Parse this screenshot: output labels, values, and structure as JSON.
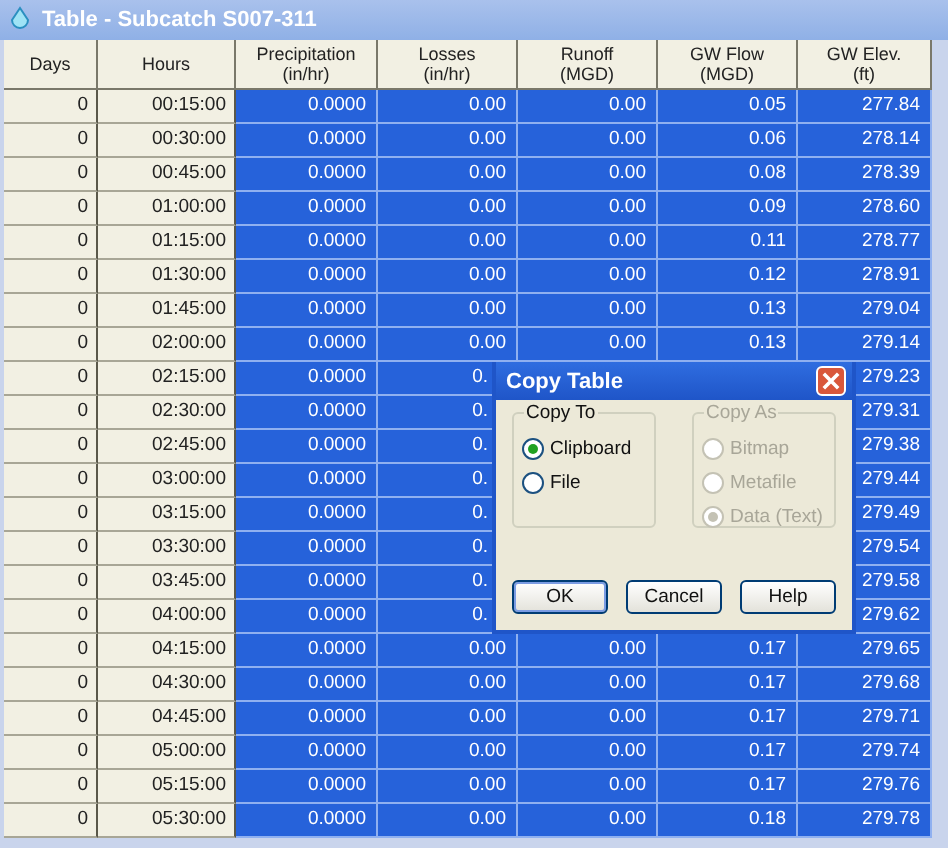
{
  "window": {
    "title": "Table - Subcatch S007-311"
  },
  "table": {
    "columns": [
      {
        "title": "Days"
      },
      {
        "title": "Hours"
      },
      {
        "title": "Precipitation",
        "unit": "(in/hr)"
      },
      {
        "title": "Losses",
        "unit": "(in/hr)"
      },
      {
        "title": "Runoff",
        "unit": "(MGD)"
      },
      {
        "title": "GW Flow",
        "unit": "(MGD)"
      },
      {
        "title": "GW Elev.",
        "unit": "(ft)"
      }
    ],
    "rows": [
      {
        "cells": [
          "0",
          "00:15:00",
          "0.0000",
          "0.00",
          "0.00",
          "0.05",
          "277.84"
        ]
      },
      {
        "cells": [
          "0",
          "00:30:00",
          "0.0000",
          "0.00",
          "0.00",
          "0.06",
          "278.14"
        ]
      },
      {
        "cells": [
          "0",
          "00:45:00",
          "0.0000",
          "0.00",
          "0.00",
          "0.08",
          "278.39"
        ]
      },
      {
        "cells": [
          "0",
          "01:00:00",
          "0.0000",
          "0.00",
          "0.00",
          "0.09",
          "278.60"
        ]
      },
      {
        "cells": [
          "0",
          "01:15:00",
          "0.0000",
          "0.00",
          "0.00",
          "0.11",
          "278.77"
        ]
      },
      {
        "cells": [
          "0",
          "01:30:00",
          "0.0000",
          "0.00",
          "0.00",
          "0.12",
          "278.91"
        ]
      },
      {
        "cells": [
          "0",
          "01:45:00",
          "0.0000",
          "0.00",
          "0.00",
          "0.13",
          "279.04"
        ]
      },
      {
        "cells": [
          "0",
          "02:00:00",
          "0.0000",
          "0.00",
          "0.00",
          "0.13",
          "279.14"
        ]
      },
      {
        "cells": [
          "0",
          "02:15:00",
          "0.0000",
          "0.",
          null,
          null,
          "279.23"
        ]
      },
      {
        "cells": [
          "0",
          "02:30:00",
          "0.0000",
          "0.",
          null,
          null,
          "279.31"
        ]
      },
      {
        "cells": [
          "0",
          "02:45:00",
          "0.0000",
          "0.",
          null,
          null,
          "279.38"
        ]
      },
      {
        "cells": [
          "0",
          "03:00:00",
          "0.0000",
          "0.",
          null,
          null,
          "279.44"
        ]
      },
      {
        "cells": [
          "0",
          "03:15:00",
          "0.0000",
          "0.",
          null,
          null,
          "279.49"
        ]
      },
      {
        "cells": [
          "0",
          "03:30:00",
          "0.0000",
          "0.",
          null,
          null,
          "279.54"
        ]
      },
      {
        "cells": [
          "0",
          "03:45:00",
          "0.0000",
          "0.",
          null,
          null,
          "279.58"
        ]
      },
      {
        "cells": [
          "0",
          "04:00:00",
          "0.0000",
          "0.",
          null,
          null,
          "279.62"
        ]
      },
      {
        "cells": [
          "0",
          "04:15:00",
          "0.0000",
          "0.00",
          "0.00",
          "0.17",
          "279.65"
        ]
      },
      {
        "cells": [
          "0",
          "04:30:00",
          "0.0000",
          "0.00",
          "0.00",
          "0.17",
          "279.68"
        ]
      },
      {
        "cells": [
          "0",
          "04:45:00",
          "0.0000",
          "0.00",
          "0.00",
          "0.17",
          "279.71"
        ]
      },
      {
        "cells": [
          "0",
          "05:00:00",
          "0.0000",
          "0.00",
          "0.00",
          "0.17",
          "279.74"
        ]
      },
      {
        "cells": [
          "0",
          "05:15:00",
          "0.0000",
          "0.00",
          "0.00",
          "0.17",
          "279.76"
        ]
      },
      {
        "cells": [
          "0",
          "05:30:00",
          "0.0000",
          "0.00",
          "0.00",
          "0.18",
          "279.78"
        ]
      }
    ]
  },
  "dialog": {
    "title": "Copy Table",
    "groups": [
      {
        "label": "Copy To",
        "disabled": false,
        "options": [
          {
            "label": "Clipboard",
            "selected": true
          },
          {
            "label": "File",
            "selected": false
          }
        ]
      },
      {
        "label": "Copy As",
        "disabled": true,
        "options": [
          {
            "label": "Bitmap",
            "selected": false
          },
          {
            "label": "Metafile",
            "selected": false
          },
          {
            "label": "Data (Text)",
            "selected": true
          }
        ]
      }
    ],
    "buttons": [
      {
        "label": "OK",
        "default": true
      },
      {
        "label": "Cancel",
        "default": false
      },
      {
        "label": "Help",
        "default": false
      }
    ]
  }
}
